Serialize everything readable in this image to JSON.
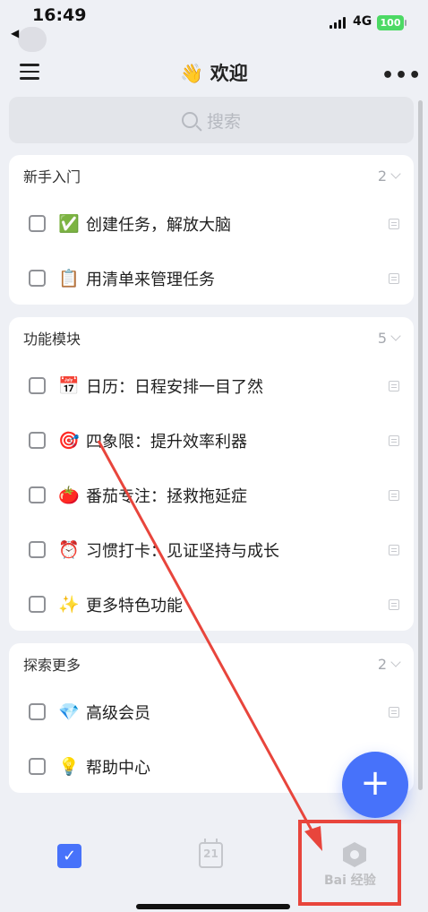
{
  "status_bar": {
    "time": "16:49",
    "back_hint": "◀",
    "network": "4G",
    "battery": "100"
  },
  "header": {
    "title": "👋 欢迎",
    "more": "•••"
  },
  "search": {
    "placeholder": "搜索"
  },
  "sections": [
    {
      "title": "新手入门",
      "count": "2",
      "tasks": [
        {
          "emoji": "✅",
          "text": "创建任务，解放大脑"
        },
        {
          "emoji": "📋",
          "text": "用清单来管理任务"
        }
      ]
    },
    {
      "title": "功能模块",
      "count": "5",
      "tasks": [
        {
          "emoji": "📅",
          "text": "日历：日程安排一目了然"
        },
        {
          "emoji": "🎯",
          "text": "四象限：提升效率利器"
        },
        {
          "emoji": "🍅",
          "text": "番茄专注：拯救拖延症"
        },
        {
          "emoji": "⏰",
          "text": "习惯打卡：见证坚持与成长"
        },
        {
          "emoji": "✨",
          "text": "更多特色功能"
        }
      ]
    },
    {
      "title": "探索更多",
      "count": "2",
      "tasks": [
        {
          "emoji": "💎",
          "text": "高级会员"
        },
        {
          "emoji": "💡",
          "text": "帮助中心"
        }
      ]
    }
  ],
  "fab": {
    "label": "+"
  },
  "bottom_nav": {
    "task_glyph": "✓",
    "calendar_day": "21"
  },
  "watermark": "Bai 经验",
  "colors": {
    "accent": "#4772fa",
    "annotation": "#e8453c",
    "background": "#eef0f5"
  }
}
